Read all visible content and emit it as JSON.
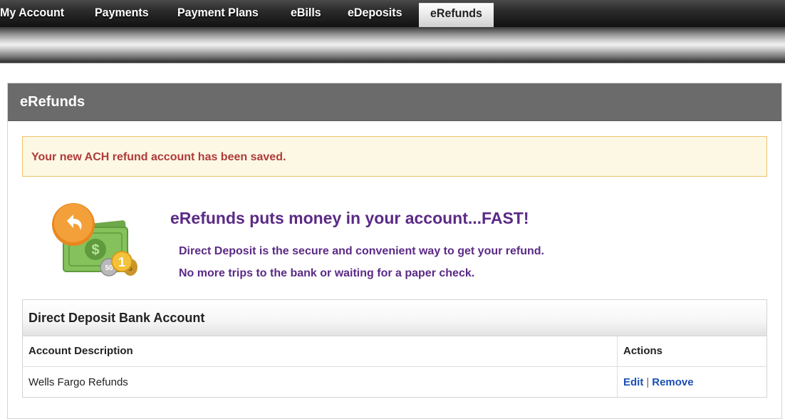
{
  "nav": {
    "tabs": [
      {
        "label": "My Account"
      },
      {
        "label": "Payments"
      },
      {
        "label": "Payment Plans"
      },
      {
        "label": "eBills"
      },
      {
        "label": "eDeposits"
      },
      {
        "label": "eRefunds",
        "active": true
      }
    ]
  },
  "panel": {
    "title": "eRefunds",
    "alert": "Your new ACH refund account has been saved."
  },
  "promo": {
    "icon": "refund-money-icon",
    "headline": "eRefunds puts money in your account...FAST!",
    "line1": "Direct Deposit is the secure and convenient way to get your refund.",
    "line2": "No more trips to the bank or waiting for a paper check."
  },
  "account_table": {
    "title": "Direct Deposit Bank Account",
    "columns": [
      "Account Description",
      "Actions"
    ],
    "rows": [
      {
        "description": "Wells Fargo Refunds",
        "edit_label": "Edit",
        "separator": "|",
        "remove_label": "Remove"
      }
    ]
  },
  "colors": {
    "panel_header": "#6b6b6b",
    "alert_bg": "#fcf8e3",
    "alert_border": "#f0c36d",
    "alert_text": "#b03a3a",
    "promo_text": "#5b2a86",
    "link": "#1b4fb3"
  }
}
